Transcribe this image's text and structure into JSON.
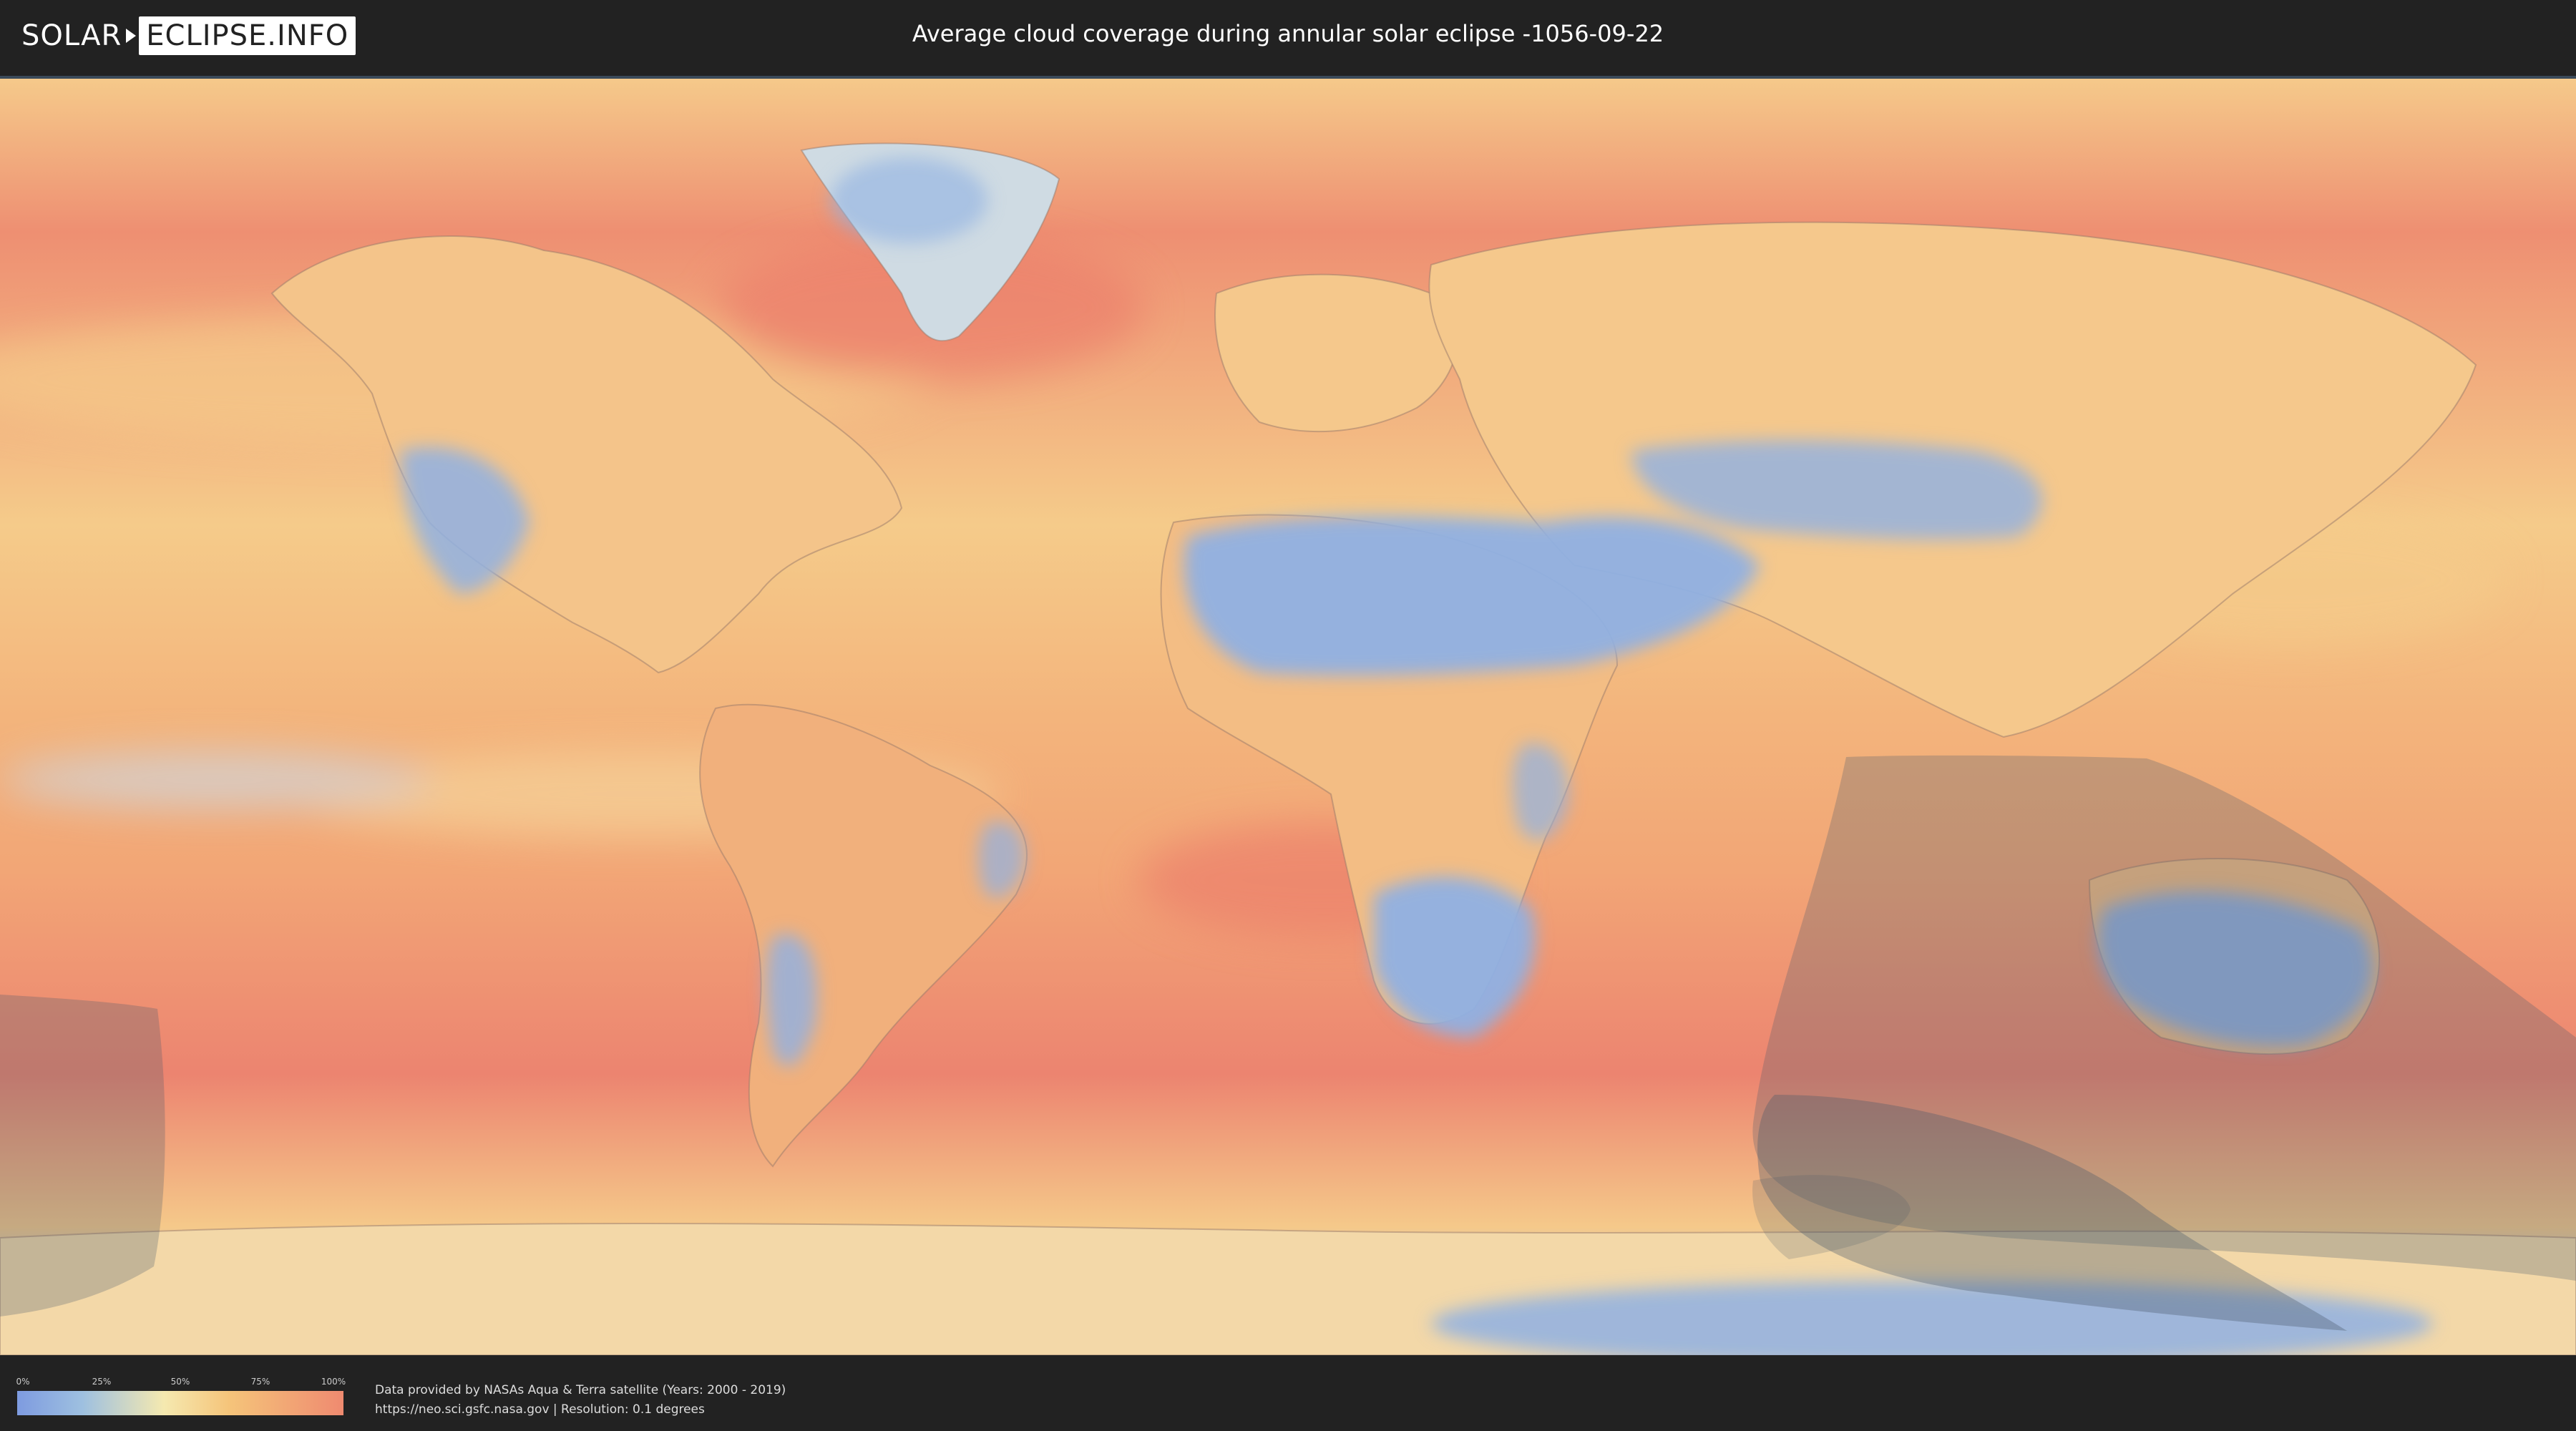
{
  "header": {
    "logo_left": "SOLAR",
    "logo_right": "ECLIPSE.INFO",
    "title": "Average cloud coverage during annular solar eclipse -1056-09-22"
  },
  "legend": {
    "ticks": [
      "0%",
      "25%",
      "50%",
      "75%",
      "100%"
    ],
    "colors": {
      "low": "#7e9be0",
      "mid": "#f5e9b0",
      "high": "#ef8a70"
    }
  },
  "footer": {
    "line1": "Data provided by NASAs Aqua & Terra satellite (Years: 2000 - 2019)",
    "line2": "https://neo.sci.gsfc.nasa.gov | Resolution: 0.1 degrees"
  },
  "map": {
    "colors": {
      "ocean": "#f1a070",
      "cloudy": "#ec7f6c",
      "moderate": "#f5cb8a",
      "clear": "#8fb0e3",
      "shadow": "#4a5a6a"
    }
  }
}
